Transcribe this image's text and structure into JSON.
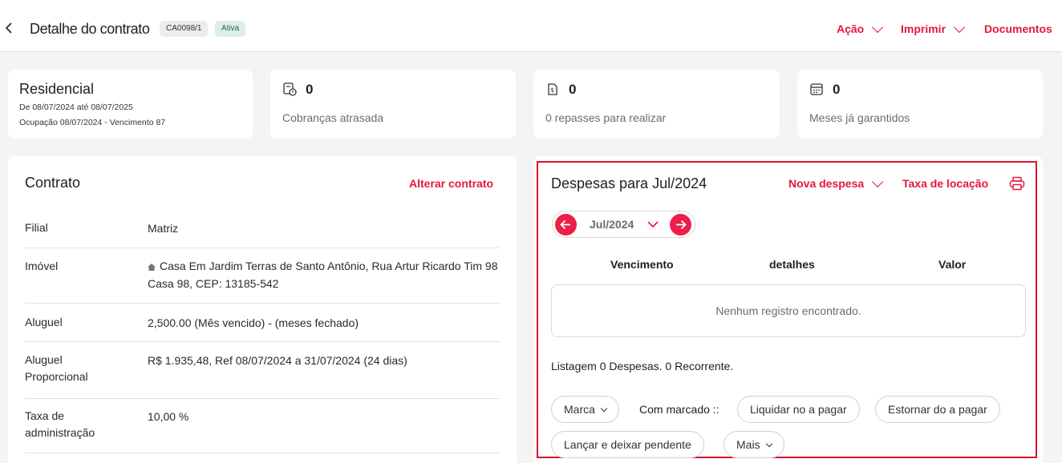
{
  "header": {
    "title": "Detalhe do contrato",
    "code_badge": "CA0098/1",
    "status_badge": "Ativa",
    "actions": [
      "Ação",
      "Imprimir",
      "Documentos"
    ]
  },
  "summary": {
    "type": "Residencial",
    "period": "De 08/07/2024 até 08/07/2025",
    "occupancy": "Ocupação 08/07/2024 - Vencimento 87"
  },
  "stats": [
    {
      "icon": "overdue-bill-icon",
      "value": "0",
      "label": "Cobranças atrasada"
    },
    {
      "icon": "transfer-icon",
      "value": "0",
      "label": "0 repasses para realizar"
    },
    {
      "icon": "calendar-icon",
      "value": "0",
      "label": "Meses já garantidos"
    }
  ],
  "contract": {
    "title": "Contrato",
    "change_link": "Alterar contrato",
    "rows": [
      {
        "label": "Filial",
        "value": "Matriz"
      },
      {
        "label": "Imóvel",
        "value": "Casa Em Jardim Terras de Santo Antônio, Rua Artur Ricardo Tim 98",
        "value2": "Casa 98, CEP: 13185-542"
      },
      {
        "label": "Aluguel",
        "value": "2,500.00 (Mês vencido) - (meses fechado)"
      },
      {
        "label": "Aluguel",
        "label2": "Proporcional",
        "value": "R$ 1.935,48, Ref 08/07/2024 a 31/07/2024 (24 dias)"
      },
      {
        "label": "Taxa de",
        "label2": "administração",
        "value": "10,00 %"
      }
    ]
  },
  "expenses": {
    "title": "Despesas para Jul/2024",
    "new_expense": "Nova despesa",
    "rental_fee": "Taxa de locação",
    "month": "Jul/2024",
    "columns": [
      "Vencimento",
      "detalhes",
      "Valor"
    ],
    "empty_message": "Nenhum registro encontrado.",
    "listing": "Listagem 0 Despesas. 0 Recorrente.",
    "mark_button": "Marca",
    "with_marked_label": "Com marcado ::",
    "settle_button": "Liquidar no a pagar",
    "reverse_button": "Estornar do a pagar",
    "post_pending_button": "Lançar e deixar pendente",
    "more_button": "Mais"
  },
  "colors": {
    "accent": "#e5173f",
    "highlight_border": "#d9132e"
  }
}
